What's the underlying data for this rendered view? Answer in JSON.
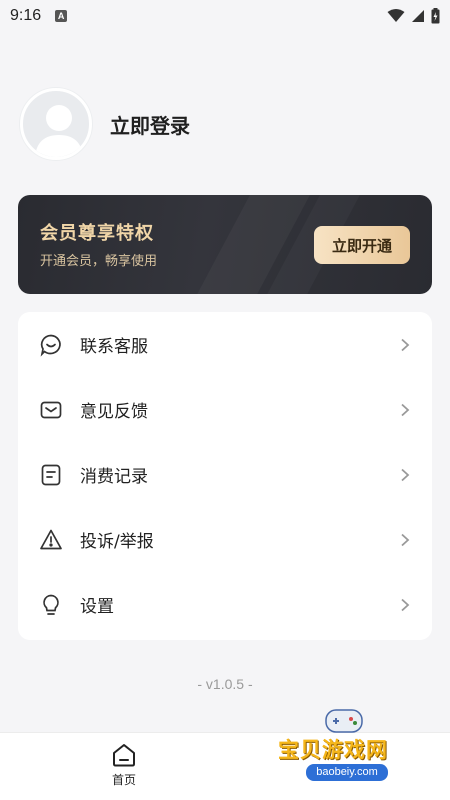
{
  "status_bar": {
    "time": "9:16",
    "notification_letter": "A",
    "icons": [
      "wifi-icon",
      "signal-icon",
      "battery-icon"
    ]
  },
  "profile": {
    "avatar_icon": "default-avatar-icon",
    "login_label": "立即登录"
  },
  "vip": {
    "title": "会员尊享特权",
    "subtitle": "开通会员，畅享使用",
    "button_label": "立即开通",
    "accent_color": "#f1d6a8"
  },
  "menu": {
    "items": [
      {
        "label": "联系客服",
        "icon": "chat-bubble-icon"
      },
      {
        "label": "意见反馈",
        "icon": "envelope-icon"
      },
      {
        "label": "消费记录",
        "icon": "receipt-icon"
      },
      {
        "label": "投诉/举报",
        "icon": "warning-icon"
      },
      {
        "label": "设置",
        "icon": "lightbulb-icon"
      }
    ]
  },
  "version": "- v1.0.5 -",
  "bottom_nav": {
    "home_label": "首页",
    "home_icon": "home-icon"
  },
  "watermark": {
    "text": "宝贝游戏网",
    "url": "baobeiy.com"
  }
}
